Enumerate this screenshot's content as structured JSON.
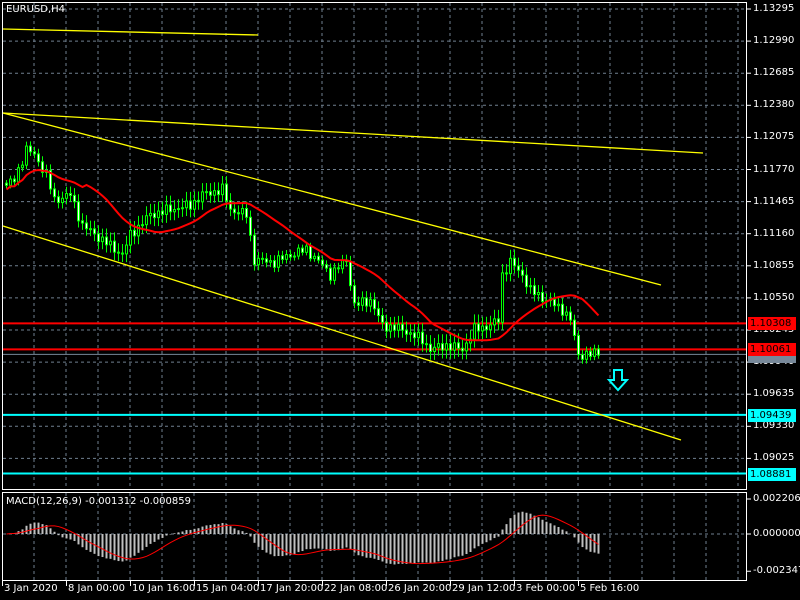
{
  "symbol_label": "EURUSD,H4",
  "colors": {
    "background": "#000000",
    "grid": "#708090",
    "candle": "#00ff00",
    "ma": "#ff0000",
    "trendline": "#ffff00",
    "support": "#00ffff",
    "resistance": "#ff0000",
    "hist": "#c0c0c0"
  },
  "price_axis": [
    "1.13295",
    "1.12990",
    "1.12685",
    "1.12380",
    "1.12075",
    "1.11770",
    "1.11465",
    "1.11160",
    "1.10855",
    "1.10550",
    "1.10245",
    "1.09940",
    "1.09635",
    "1.09330",
    "1.09025"
  ],
  "price_tags": [
    {
      "value": "1.10308",
      "price": 1.10308,
      "color": "#ff0000"
    },
    {
      "value": "1.10061",
      "price": 1.10061,
      "color": "#ff0000"
    },
    {
      "value": "1.09439",
      "price": 1.09439,
      "color": "#00ffff"
    },
    {
      "value": "1.08881",
      "price": 1.08881,
      "color": "#00ffff"
    }
  ],
  "macd": {
    "label": "MACD(12,26,9) -0.001312 -0.000859",
    "axis": [
      "0.002206",
      "0.000000",
      "-0.002347"
    ]
  },
  "time_axis": [
    "3 Jan 2020",
    "8 Jan 00:00",
    "10 Jan 16:00",
    "15 Jan 04:00",
    "17 Jan 20:00",
    "22 Jan 08:00",
    "26 Jan 20:00",
    "29 Jan 12:00",
    "3 Feb 00:00",
    "5 Feb 16:00"
  ],
  "chart_data": {
    "type": "candlestick",
    "symbol": "EURUSD",
    "timeframe": "H4",
    "ylim": [
      1.0872,
      1.1335
    ],
    "bid": 1.10013,
    "close_keypoints": [
      [
        0,
        1.1162
      ],
      [
        2,
        1.1167
      ],
      [
        5,
        1.1196
      ],
      [
        7,
        1.1191
      ],
      [
        10,
        1.1172
      ],
      [
        12,
        1.1148
      ],
      [
        16,
        1.1153
      ],
      [
        19,
        1.1124
      ],
      [
        24,
        1.111
      ],
      [
        29,
        1.1096
      ],
      [
        31,
        1.1115
      ],
      [
        36,
        1.1134
      ],
      [
        41,
        1.1139
      ],
      [
        46,
        1.1143
      ],
      [
        49,
        1.1153
      ],
      [
        54,
        1.1158
      ],
      [
        56,
        1.1139
      ],
      [
        60,
        1.1134
      ],
      [
        62,
        1.1091
      ],
      [
        67,
        1.1089
      ],
      [
        71,
        1.1096
      ],
      [
        75,
        1.1101
      ],
      [
        79,
        1.1086
      ],
      [
        81,
        1.1077
      ],
      [
        85,
        1.1091
      ],
      [
        87,
        1.1048
      ],
      [
        91,
        1.1053
      ],
      [
        94,
        1.1029
      ],
      [
        99,
        1.1025
      ],
      [
        104,
        1.1015
      ],
      [
        106,
        1.1006
      ],
      [
        110,
        1.101
      ],
      [
        114,
        1.1006
      ],
      [
        117,
        1.1025
      ],
      [
        121,
        1.1029
      ],
      [
        123,
        1.1034
      ],
      [
        124,
        1.1077
      ],
      [
        126,
        1.1089
      ],
      [
        129,
        1.1077
      ],
      [
        131,
        1.1062
      ],
      [
        135,
        1.1053
      ],
      [
        139,
        1.1044
      ],
      [
        141,
        1.1034
      ],
      [
        143,
        1.1001
      ],
      [
        146,
        1.1001
      ],
      [
        148,
        1.1004
      ]
    ]
  }
}
